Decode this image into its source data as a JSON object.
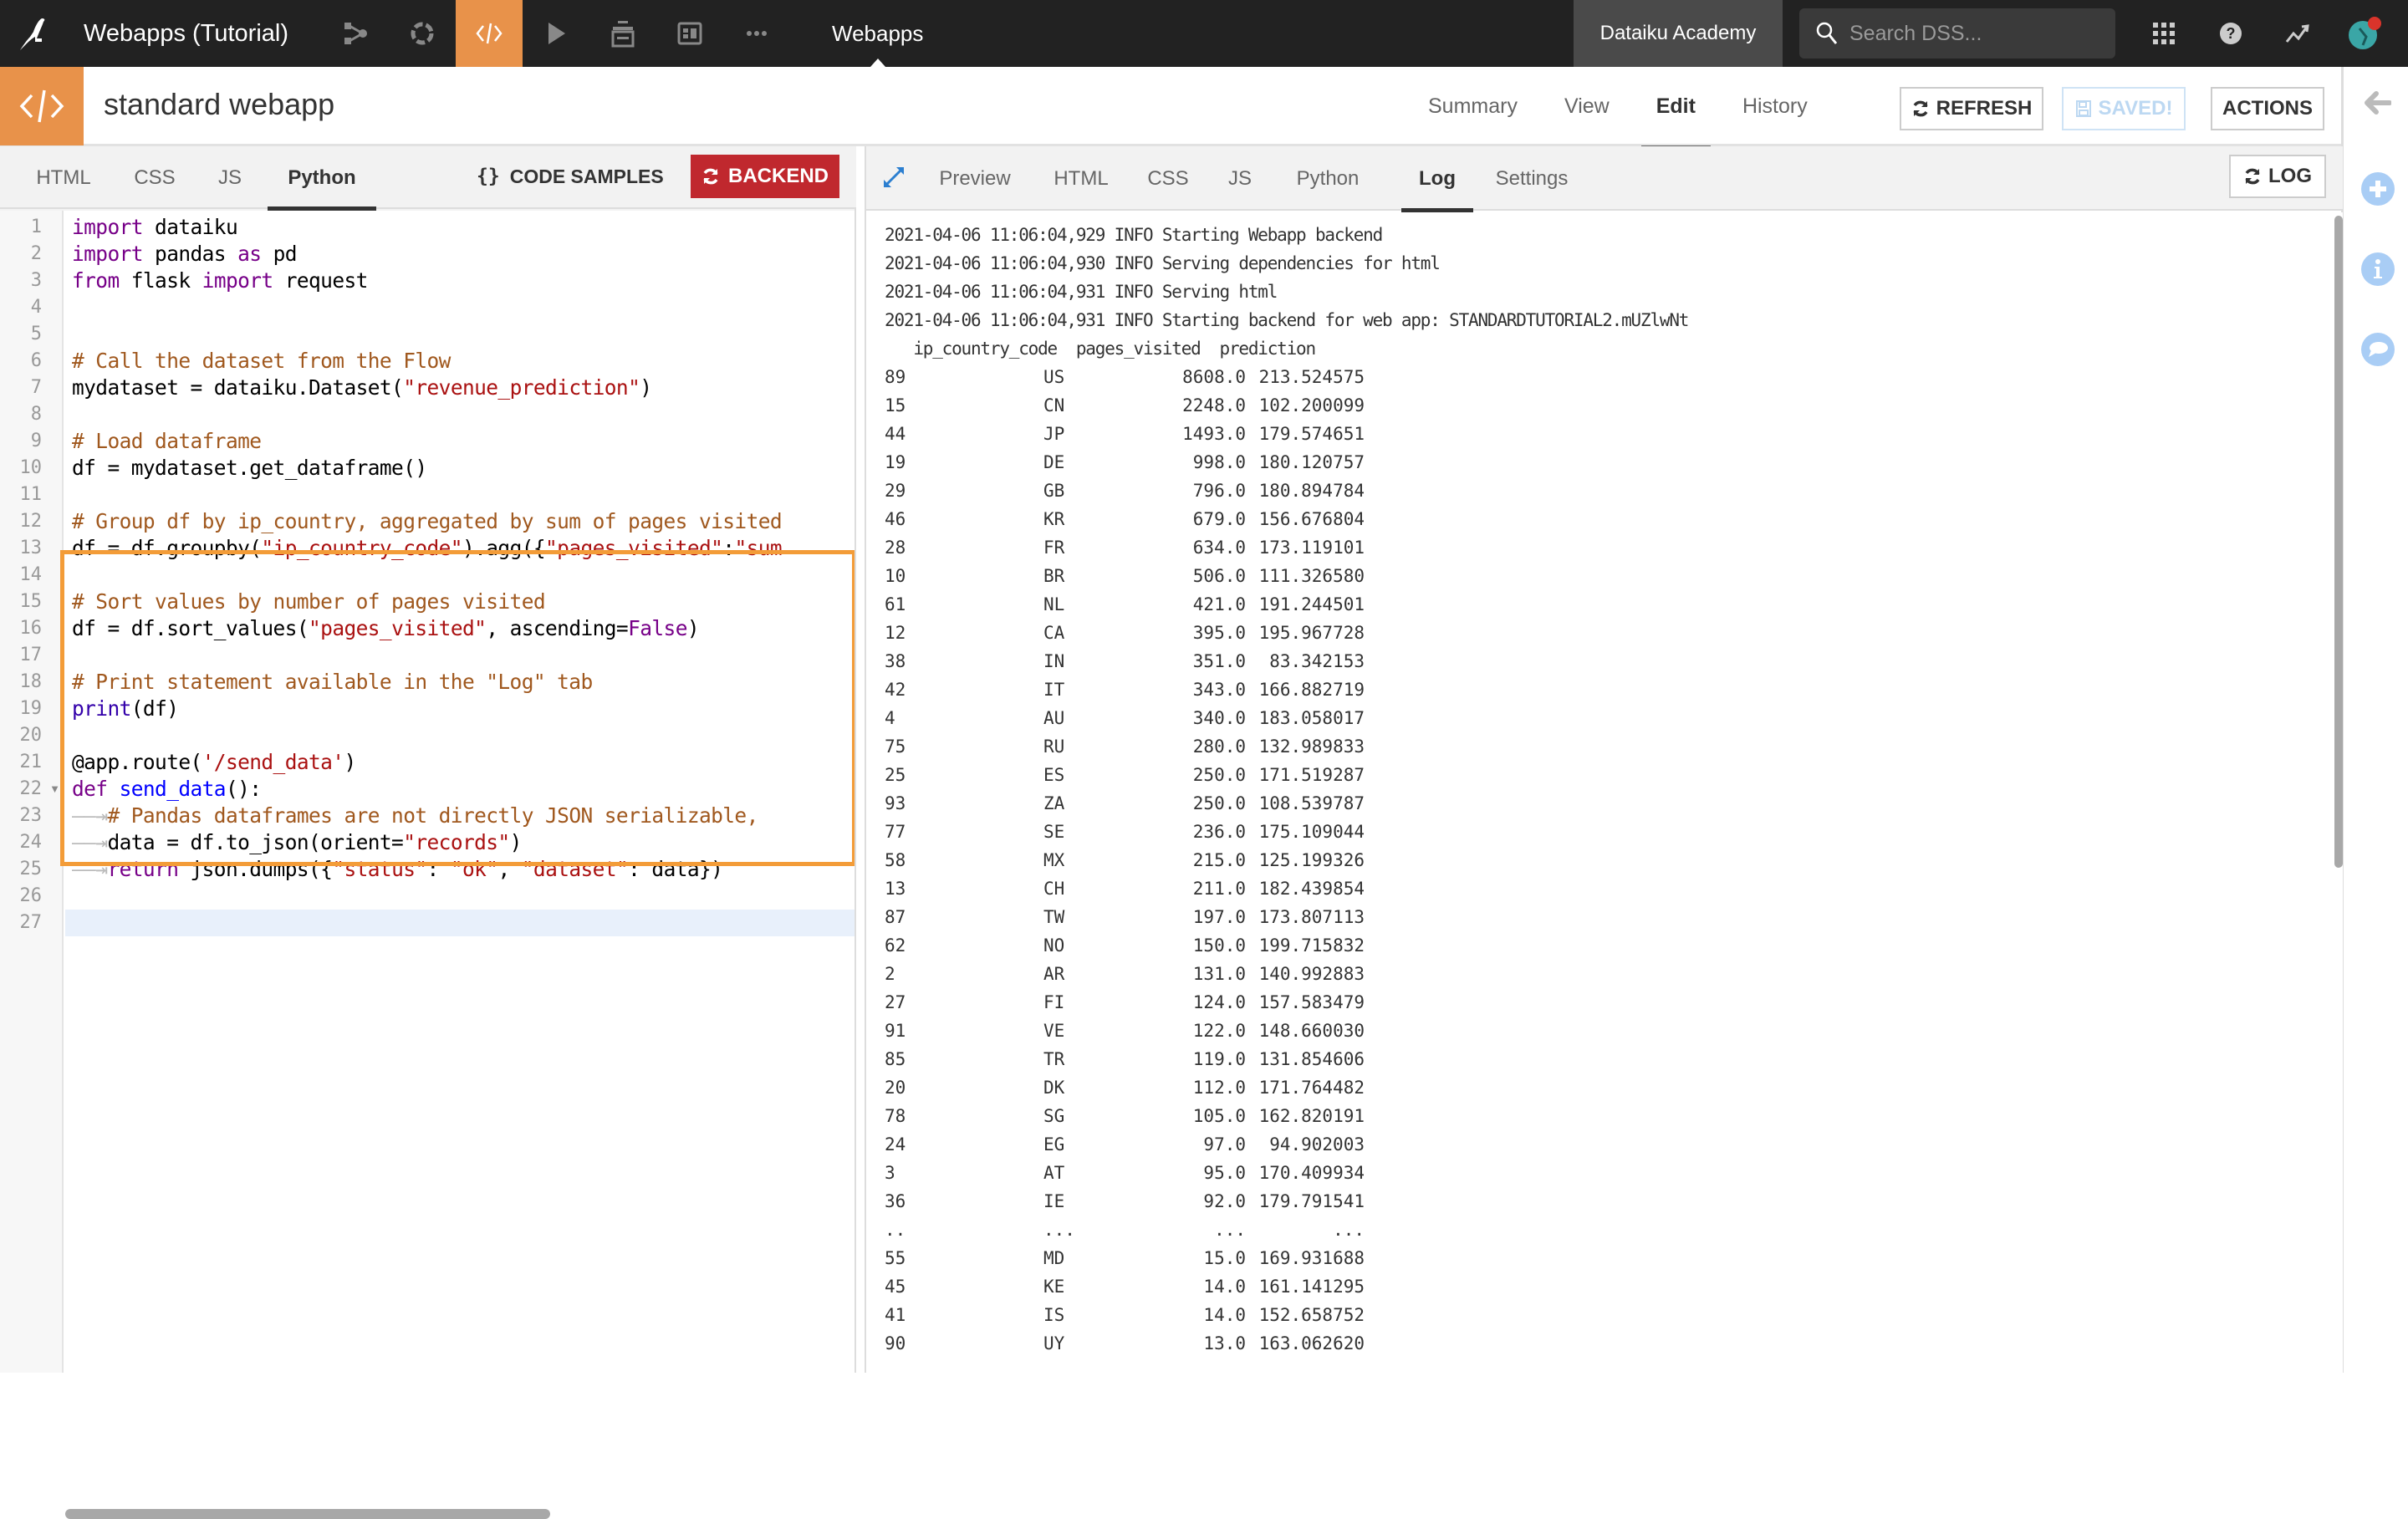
{
  "navbar": {
    "project_name": "Webapps (Tutorial)",
    "section_label": "Webapps",
    "academy_label": "Dataiku Academy",
    "search_placeholder": "Search DSS...",
    "icons": [
      "dataiku-bird-logo",
      "flow-icon",
      "lab-icon",
      "code-icon",
      "run-icon",
      "datasets-icon",
      "dashboard-icon",
      "more-icon"
    ],
    "right_icons": [
      "apps-grid-icon",
      "help-icon",
      "activity-icon",
      "user-avatar"
    ],
    "colors": {
      "bg": "#222222",
      "active": "#e8924a",
      "notification": "#d9342b"
    }
  },
  "header": {
    "title": "standard webapp",
    "tabs": [
      {
        "label": "Summary",
        "active": false
      },
      {
        "label": "View",
        "active": false
      },
      {
        "label": "Edit",
        "active": true
      },
      {
        "label": "History",
        "active": false
      }
    ],
    "refresh_label": "REFRESH",
    "saved_label": "SAVED!",
    "actions_label": "ACTIONS"
  },
  "editor": {
    "tabs": [
      {
        "label": "HTML",
        "active": false
      },
      {
        "label": "CSS",
        "active": false
      },
      {
        "label": "JS",
        "active": false
      },
      {
        "label": "Python",
        "active": true
      }
    ],
    "code_samples_label": "CODE SAMPLES",
    "backend_label": "BACKEND",
    "lines": [
      "import dataiku",
      "import pandas as pd",
      "from flask import request",
      "",
      "",
      "# Call the dataset from the Flow",
      "mydataset = dataiku.Dataset(\"revenue_prediction\")",
      "",
      "# Load dataframe",
      "df = mydataset.get_dataframe()",
      "",
      "# Group df by ip_country, aggregated by sum of pages visited",
      "df = df.groupby(\"ip_country_code\").agg({\"pages_visited\":\"sum",
      "",
      "# Sort values by number of pages visited",
      "df = df.sort_values(\"pages_visited\", ascending=False)",
      "",
      "# Print statement available in the \"Log\" tab",
      "print(df)",
      "",
      "@app.route('/send_data')",
      "def send_data():",
      "    # Pandas dataframes are not directly JSON serializable,",
      "    data = df.to_json(orient=\"records\")",
      "    return json.dumps({\"status\": \"ok\", \"dataset\": data})",
      "",
      ""
    ],
    "line_count": 27,
    "active_line": 27,
    "highlight_color": "#f39c38"
  },
  "preview": {
    "tabs": [
      {
        "label": "Preview",
        "active": false
      },
      {
        "label": "HTML",
        "active": false
      },
      {
        "label": "CSS",
        "active": false
      },
      {
        "label": "JS",
        "active": false
      },
      {
        "label": "Python",
        "active": false
      },
      {
        "label": "Log",
        "active": true
      },
      {
        "label": "Settings",
        "active": false
      }
    ],
    "log_button_label": "LOG",
    "log_messages": [
      "2021-04-06 11:06:04,929 INFO Starting Webapp backend",
      "2021-04-06 11:06:04,930 INFO Serving dependencies for html",
      "2021-04-06 11:06:04,931 INFO Serving html",
      "2021-04-06 11:06:04,931 INFO Starting backend for web app: STANDARDTUTORIAL2.mUZlwNt"
    ],
    "table_header": "   ip_country_code  pages_visited  prediction",
    "table_rows": [
      {
        "idx": "89",
        "code": "US",
        "pages": "8608.0",
        "pred": "213.524575"
      },
      {
        "idx": "15",
        "code": "CN",
        "pages": "2248.0",
        "pred": "102.200099"
      },
      {
        "idx": "44",
        "code": "JP",
        "pages": "1493.0",
        "pred": "179.574651"
      },
      {
        "idx": "19",
        "code": "DE",
        "pages": "998.0",
        "pred": "180.120757"
      },
      {
        "idx": "29",
        "code": "GB",
        "pages": "796.0",
        "pred": "180.894784"
      },
      {
        "idx": "46",
        "code": "KR",
        "pages": "679.0",
        "pred": "156.676804"
      },
      {
        "idx": "28",
        "code": "FR",
        "pages": "634.0",
        "pred": "173.119101"
      },
      {
        "idx": "10",
        "code": "BR",
        "pages": "506.0",
        "pred": "111.326580"
      },
      {
        "idx": "61",
        "code": "NL",
        "pages": "421.0",
        "pred": "191.244501"
      },
      {
        "idx": "12",
        "code": "CA",
        "pages": "395.0",
        "pred": "195.967728"
      },
      {
        "idx": "38",
        "code": "IN",
        "pages": "351.0",
        "pred": "83.342153"
      },
      {
        "idx": "42",
        "code": "IT",
        "pages": "343.0",
        "pred": "166.882719"
      },
      {
        "idx": "4",
        "code": "AU",
        "pages": "340.0",
        "pred": "183.058017"
      },
      {
        "idx": "75",
        "code": "RU",
        "pages": "280.0",
        "pred": "132.989833"
      },
      {
        "idx": "25",
        "code": "ES",
        "pages": "250.0",
        "pred": "171.519287"
      },
      {
        "idx": "93",
        "code": "ZA",
        "pages": "250.0",
        "pred": "108.539787"
      },
      {
        "idx": "77",
        "code": "SE",
        "pages": "236.0",
        "pred": "175.109044"
      },
      {
        "idx": "58",
        "code": "MX",
        "pages": "215.0",
        "pred": "125.199326"
      },
      {
        "idx": "13",
        "code": "CH",
        "pages": "211.0",
        "pred": "182.439854"
      },
      {
        "idx": "87",
        "code": "TW",
        "pages": "197.0",
        "pred": "173.807113"
      },
      {
        "idx": "62",
        "code": "NO",
        "pages": "150.0",
        "pred": "199.715832"
      },
      {
        "idx": "2",
        "code": "AR",
        "pages": "131.0",
        "pred": "140.992883"
      },
      {
        "idx": "27",
        "code": "FI",
        "pages": "124.0",
        "pred": "157.583479"
      },
      {
        "idx": "91",
        "code": "VE",
        "pages": "122.0",
        "pred": "148.660030"
      },
      {
        "idx": "85",
        "code": "TR",
        "pages": "119.0",
        "pred": "131.854606"
      },
      {
        "idx": "20",
        "code": "DK",
        "pages": "112.0",
        "pred": "171.764482"
      },
      {
        "idx": "78",
        "code": "SG",
        "pages": "105.0",
        "pred": "162.820191"
      },
      {
        "idx": "24",
        "code": "EG",
        "pages": "97.0",
        "pred": "94.902003"
      },
      {
        "idx": "3",
        "code": "AT",
        "pages": "95.0",
        "pred": "170.409934"
      },
      {
        "idx": "36",
        "code": "IE",
        "pages": "92.0",
        "pred": "179.791541"
      },
      {
        "idx": "..",
        "code": "...",
        "pages": "...",
        "pred": "..."
      },
      {
        "idx": "55",
        "code": "MD",
        "pages": "15.0",
        "pred": "169.931688"
      },
      {
        "idx": "45",
        "code": "KE",
        "pages": "14.0",
        "pred": "161.141295"
      },
      {
        "idx": "41",
        "code": "IS",
        "pages": "14.0",
        "pred": "152.658752"
      },
      {
        "idx": "90",
        "code": "UY",
        "pages": "13.0",
        "pred": "163.062620"
      }
    ]
  },
  "right_rail": {
    "icons": [
      "back-arrow-icon",
      "add-icon",
      "info-icon",
      "discussion-icon"
    ],
    "accent": "#a9cdf5"
  }
}
